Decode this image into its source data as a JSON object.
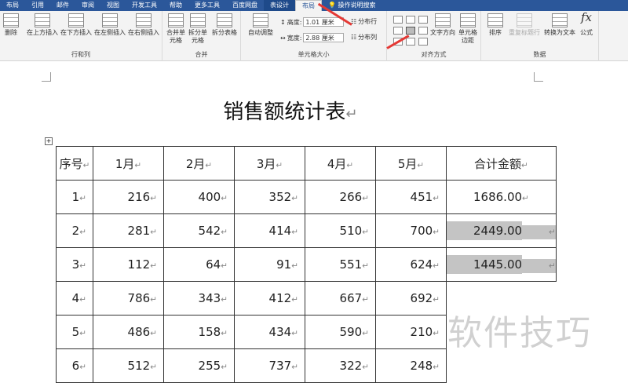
{
  "tabs": [
    "布局",
    "引用",
    "邮件",
    "审阅",
    "视图",
    "开发工具",
    "帮助",
    "更多工具",
    "百度网盘",
    "表设计",
    "布局"
  ],
  "search": "操作说明搜索",
  "ribbon": {
    "rows_cols": {
      "label": "行和列",
      "buttons": [
        "删除",
        "在上方插入",
        "在下方插入",
        "在左侧插入",
        "在右侧插入"
      ]
    },
    "merge": {
      "label": "合并",
      "buttons": [
        "合并单元格",
        "拆分单元格",
        "拆分表格"
      ]
    },
    "cell_size": {
      "label": "单元格大小",
      "autofit": "自动调整",
      "height_label": "高度:",
      "height_value": "1.01 厘米",
      "width_label": "宽度:",
      "width_value": "2.88 厘米",
      "dist_rows": "分布行",
      "dist_cols": "分布列"
    },
    "alignment": {
      "label": "对齐方式",
      "text_dir": "文字方向",
      "cell_margin": "单元格边距"
    },
    "data": {
      "label": "数据",
      "buttons": [
        "排序",
        "重复标题行",
        "转换为文本",
        "公式"
      ]
    }
  },
  "doc": {
    "title": "销售额统计表",
    "headers": [
      "序号",
      "1月",
      "2月",
      "3月",
      "4月",
      "5月",
      "合计金额"
    ],
    "rows": [
      [
        "1",
        "216",
        "400",
        "352",
        "266",
        "451",
        "1686.00"
      ],
      [
        "2",
        "281",
        "542",
        "414",
        "510",
        "700",
        "2449.00"
      ],
      [
        "3",
        "112",
        "64",
        "91",
        "551",
        "624",
        "1445.00"
      ],
      [
        "4",
        "786",
        "343",
        "412",
        "667",
        "692",
        ""
      ],
      [
        "5",
        "486",
        "158",
        "434",
        "590",
        "210",
        ""
      ],
      [
        "6",
        "512",
        "255",
        "737",
        "322",
        "248",
        ""
      ]
    ]
  },
  "watermark": "软件技巧",
  "colors": {
    "ribbon_blue": "#2b579a",
    "highlight": "#c4c4c4",
    "arrow": "#e53935"
  }
}
